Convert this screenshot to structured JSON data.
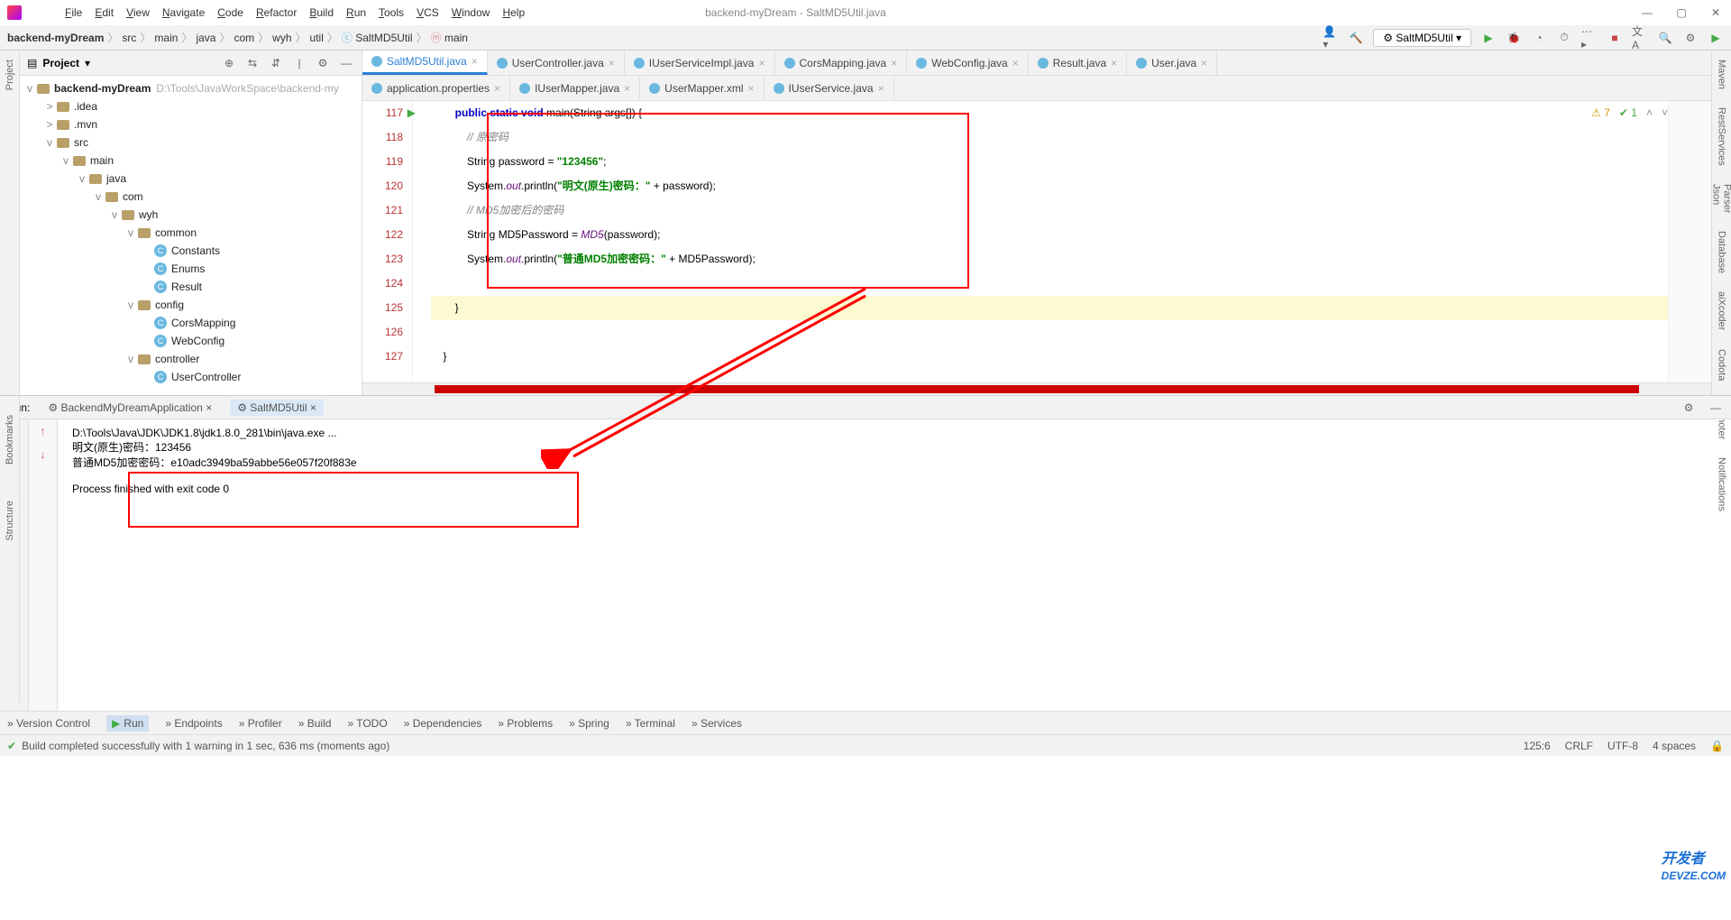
{
  "window": {
    "title": "backend-myDream - SaltMD5Util.java"
  },
  "menu": [
    "File",
    "Edit",
    "View",
    "Navigate",
    "Code",
    "Refactor",
    "Build",
    "Run",
    "Tools",
    "VCS",
    "Window",
    "Help"
  ],
  "breadcrumb": [
    "backend-myDream",
    "src",
    "main",
    "java",
    "com",
    "wyh",
    "util",
    "SaltMD5Util",
    "main"
  ],
  "runconfig": "SaltMD5Util",
  "project": {
    "title": "Project",
    "root": "backend-myDream",
    "root_path": "D:\\Tools\\JavaWorkSpace\\backend-my",
    "nodes": [
      {
        "indent": 1,
        "arrow": ">",
        "type": "folder",
        "label": ".idea"
      },
      {
        "indent": 1,
        "arrow": ">",
        "type": "folder",
        "label": ".mvn"
      },
      {
        "indent": 1,
        "arrow": "v",
        "type": "folder",
        "label": "src"
      },
      {
        "indent": 2,
        "arrow": "v",
        "type": "folder",
        "label": "main"
      },
      {
        "indent": 3,
        "arrow": "v",
        "type": "folder",
        "label": "java"
      },
      {
        "indent": 4,
        "arrow": "v",
        "type": "folder",
        "label": "com"
      },
      {
        "indent": 5,
        "arrow": "v",
        "type": "folder",
        "label": "wyh"
      },
      {
        "indent": 6,
        "arrow": "v",
        "type": "folder",
        "label": "common"
      },
      {
        "indent": 7,
        "arrow": "",
        "type": "class",
        "label": "Constants"
      },
      {
        "indent": 7,
        "arrow": "",
        "type": "class",
        "label": "Enums"
      },
      {
        "indent": 7,
        "arrow": "",
        "type": "class",
        "label": "Result"
      },
      {
        "indent": 6,
        "arrow": "v",
        "type": "folder",
        "label": "config"
      },
      {
        "indent": 7,
        "arrow": "",
        "type": "class",
        "label": "CorsMapping"
      },
      {
        "indent": 7,
        "arrow": "",
        "type": "class",
        "label": "WebConfig"
      },
      {
        "indent": 6,
        "arrow": "v",
        "type": "folder",
        "label": "controller"
      },
      {
        "indent": 7,
        "arrow": "",
        "type": "class",
        "label": "UserController"
      }
    ]
  },
  "tabs_row1": [
    {
      "label": "SaltMD5Util.java",
      "active": true
    },
    {
      "label": "UserController.java"
    },
    {
      "label": "IUserServiceImpl.java"
    },
    {
      "label": "CorsMapping.java"
    },
    {
      "label": "WebConfig.java"
    },
    {
      "label": "Result.java"
    },
    {
      "label": "User.java"
    }
  ],
  "tabs_row2": [
    {
      "label": "application.properties"
    },
    {
      "label": "IUserMapper.java"
    },
    {
      "label": "UserMapper.xml"
    },
    {
      "label": "IUserService.java"
    }
  ],
  "gutter_lines": [
    "117",
    "118",
    "119",
    "120",
    "121",
    "122",
    "123",
    "124",
    "125",
    "126",
    "127"
  ],
  "code_lines": [
    {
      "html": "        <span class='kw'>public static void</span> main(String args[]) {"
    },
    {
      "html": "            <span class='cmt'>// 原密码</span>"
    },
    {
      "html": "            String password = <span class='str'>\"123456\"</span>;"
    },
    {
      "html": "            System.<span class='fld'>out</span>.println(<span class='str'>\"明文(原生)密码：\"</span> + password);"
    },
    {
      "html": "            <span class='cmt'>// MD5加密后的密码</span>"
    },
    {
      "html": "            String MD5Password = <span class='fld'>MD5</span>(password);"
    },
    {
      "html": "            System.<span class='fld'>out</span>.println(<span class='str'>\"普通MD5加密密码：\"</span> + MD5Password);"
    },
    {
      "html": " "
    },
    {
      "html": "        }",
      "hl": true
    },
    {
      "html": " "
    },
    {
      "html": "    }"
    }
  ],
  "warnings": {
    "a": "7",
    "b": "1"
  },
  "run": {
    "label": "Run:",
    "tabs": [
      "BackendMyDreamApplication",
      "SaltMD5Util"
    ],
    "cmd": "D:\\Tools\\Java\\JDK\\JDK1.8\\jdk1.8.0_281\\bin\\java.exe ...",
    "out1": "明文(原生)密码：123456",
    "out2": "普通MD5加密密码：e10adc3949ba59abbe56e057f20f883e",
    "exit": "Process finished with exit code 0"
  },
  "bottom_tabs": [
    "Version Control",
    "Run",
    "Endpoints",
    "Profiler",
    "Build",
    "TODO",
    "Dependencies",
    "Problems",
    "Spring",
    "Terminal",
    "Services"
  ],
  "status": {
    "msg": "Build completed successfully with 1 warning in 1 sec, 636 ms (moments ago)",
    "pos": "125:6",
    "eol": "CRLF",
    "enc": "UTF-8",
    "indent": "4 spaces"
  },
  "right_tabs": [
    "Maven",
    "RestServices",
    "Json Parser",
    "Database",
    "aiXcoder",
    "Codota",
    "Key Promoter X",
    "Notifications"
  ],
  "left_tabs": [
    "Project",
    "Bookmarks",
    "Structure"
  ],
  "watermark": "开发者\nDevZe.CoM"
}
